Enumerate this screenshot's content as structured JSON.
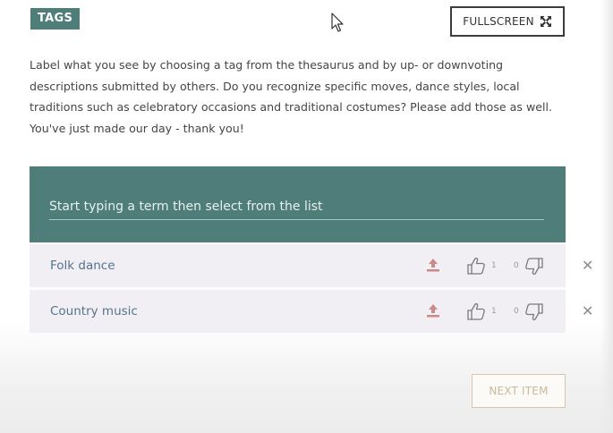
{
  "header": {
    "badge": "TAGS",
    "fullscreen_label": "FULLSCREEN"
  },
  "description": "Label what you see by choosing a tag from the thesaurus and by up- or downvoting descriptions submitted by others. Do you recognize specific moves, dance styles, local traditions such as celebratory occasions and traditional costumes? Please add those as well. You've just made our day - thank you!",
  "search": {
    "placeholder": "Start typing a term then select from the list",
    "value": ""
  },
  "tags": [
    {
      "label": "Folk dance",
      "upvotes": "1",
      "downvotes": "0"
    },
    {
      "label": "Country music",
      "upvotes": "1",
      "downvotes": "0"
    }
  ],
  "footer": {
    "next_label": "NEXT ITEM"
  },
  "colors": {
    "accent": "#4f7d79",
    "row_bg": "#f1eff4",
    "upload_icon": "#c98a8a",
    "next_border": "#d7c6ab"
  }
}
